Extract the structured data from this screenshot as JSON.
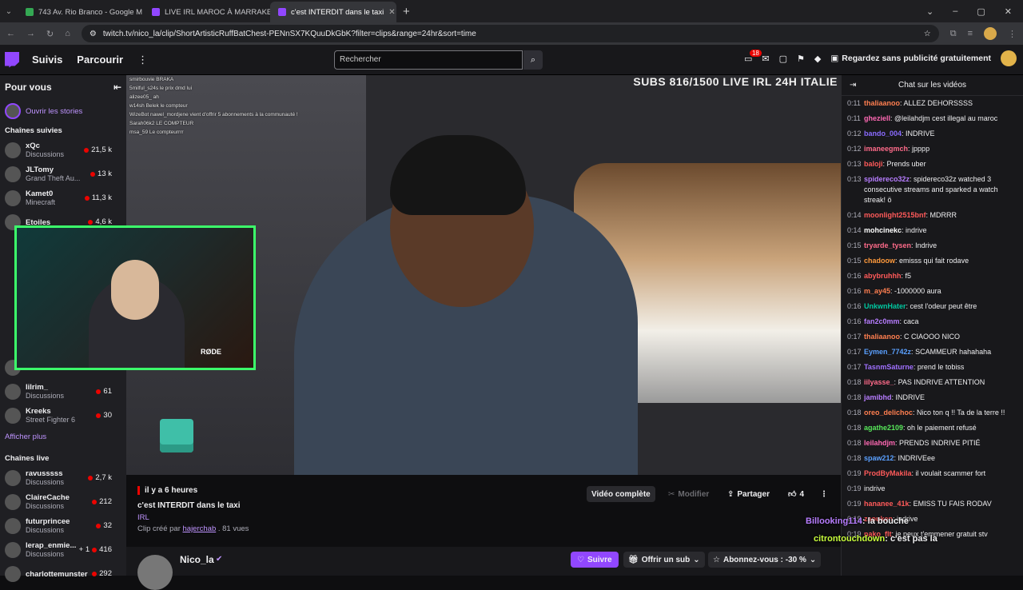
{
  "browser": {
    "tabs": [
      {
        "label": "743 Av. Rio Branco - Google M",
        "color": "#34a853",
        "active": false
      },
      {
        "label": "LIVE IRL MAROC À MARRAKECH",
        "color": "#9147ff",
        "active": false
      },
      {
        "label": "c'est INTERDIT dans le taxi",
        "color": "#9147ff",
        "active": true
      }
    ],
    "url": "twitch.tv/nico_la/clip/ShortArtisticRuffBatChest-PENnSX7KQuuDkGbK?filter=clips&range=24hr&sort=time"
  },
  "nav": {
    "following": "Suivis",
    "browse": "Parcourir",
    "search_placeholder": "Rechercher",
    "notif_count": "18",
    "promo": "Regardez sans publicité gratuitement"
  },
  "sidebar": {
    "title": "Pour vous",
    "stories": "Ouvrir les stories",
    "followed_title": "Chaînes suivies",
    "show_more": "Afficher plus",
    "live_title": "Chaînes live",
    "followed": [
      {
        "name": "xQc",
        "cat": "Discussions",
        "count": "21,5 k"
      },
      {
        "name": "JLTomy",
        "cat": "Grand Theft Au...",
        "count": "13 k"
      },
      {
        "name": "Kamet0",
        "cat": "Minecraft",
        "count": "11,3 k"
      },
      {
        "name": "Etoiles",
        "cat": "",
        "count": "4,6 k"
      }
    ],
    "followed_after": [
      {
        "name": "",
        "cat": "Discussions",
        "count": ""
      },
      {
        "name": "lilrim_",
        "cat": "Discussions",
        "count": "61"
      },
      {
        "name": "Kreeks",
        "cat": "Street Fighter 6",
        "count": "30"
      }
    ],
    "live": [
      {
        "name": "ravusssss",
        "cat": "Discussions",
        "count": "2,7 k"
      },
      {
        "name": "ClaireCache",
        "cat": "Discussions",
        "count": "212"
      },
      {
        "name": "futurprincee",
        "cat": "Discussions",
        "count": "32"
      },
      {
        "name": "lerap_enmie...",
        "extra": "+ 1",
        "cat": "Discussions",
        "count": "416"
      },
      {
        "name": "charlottemunster",
        "cat": "",
        "count": "292"
      }
    ]
  },
  "video": {
    "overlay_title": "SUBS 816/1500 LIVE IRL 24H ITALIE",
    "stream_chat": [
      "smirbouvie BRAKA",
      "5milful_s24s le prix dmd lui",
      "alizee05_ ah",
      "w14sh Belek le compteur",
      "WizeBot nawel_mordjene vient d'offrir 5 abonnements à la communauté !",
      "Sarah06k2 LE COMPTEUR",
      "msa_59 Le compteurrrr"
    ],
    "mic_label": "RØDE"
  },
  "clip": {
    "time": "il y a 6 heures",
    "title": "c'est INTERDIT dans le taxi",
    "category": "IRL",
    "created_prefix": "Clip créé par",
    "creator": "hajerchab",
    "views": ". 81 vues",
    "full_video": "Vidéo complète",
    "edit": "Modifier",
    "share": "Partager",
    "likes": "4"
  },
  "channel": {
    "name": "Nico_la",
    "follow": "Suivre",
    "gift": "Offrir un sub",
    "subscribe": "Abonnez-vous : -30 %"
  },
  "chat": {
    "title": "Chat sur les vidéos",
    "messages": [
      {
        "t": "0:11",
        "u": "thaliaanoo",
        "c": "#ff7f50",
        "m": "ALLEZ DEHORSSSS"
      },
      {
        "t": "0:11",
        "u": "gheziell",
        "c": "#ff69b4",
        "m": "@leilahdjm cest illegal au maroc"
      },
      {
        "t": "0:12",
        "u": "bando_004",
        "c": "#8a6bff",
        "m": "INDRIVE"
      },
      {
        "t": "0:12",
        "u": "imaneegmch",
        "c": "#ff6b8a",
        "m": "jpppp"
      },
      {
        "t": "0:13",
        "u": "baloji",
        "c": "#ff5a5a",
        "m": "Prends uber"
      },
      {
        "t": "0:13",
        "u": "spidereco32z",
        "c": "#b77dff",
        "m": "spidereco32z watched 3 consecutive streams and sparked a watch streak! ö"
      },
      {
        "t": "0:14",
        "u": "moonlight2515bnf",
        "c": "#ff5a5a",
        "m": "MDRRR"
      },
      {
        "t": "0:14",
        "u": "mohcinekc",
        "c": "#ffffff",
        "m": "indrive"
      },
      {
        "t": "0:15",
        "u": "tryarde_tysen",
        "c": "#ff6b8a",
        "m": "Indrive"
      },
      {
        "t": "0:15",
        "u": "chadoow",
        "c": "#ff9a3c",
        "m": "emisss qui fait rodave"
      },
      {
        "t": "0:16",
        "u": "abybruhhh",
        "c": "#ff5a5a",
        "m": "f5"
      },
      {
        "t": "0:16",
        "u": "m_ay45",
        "c": "#ff7f50",
        "m": "-1000000 aura"
      },
      {
        "t": "0:16",
        "u": "UnkwnHater",
        "c": "#00c8a0",
        "m": "cest l'odeur peut être"
      },
      {
        "t": "0:16",
        "u": "fan2c0mm",
        "c": "#b77dff",
        "m": "caca"
      },
      {
        "t": "0:17",
        "u": "thaliaanoo",
        "c": "#ff7f50",
        "m": "C CIAOOO NICO"
      },
      {
        "t": "0:17",
        "u": "Eymen_7742z",
        "c": "#5aa0ff",
        "m": "SCAMMEUR hahahaha"
      },
      {
        "t": "0:17",
        "u": "TasnmSaturne",
        "c": "#a070ff",
        "m": "prend le tobiss"
      },
      {
        "t": "0:18",
        "u": "iilyasse_",
        "c": "#ff6b8a",
        "m": "PAS INDRIVE ATTENTION"
      },
      {
        "t": "0:18",
        "u": "jamibhd",
        "c": "#b77dff",
        "m": "INDRIVE"
      },
      {
        "t": "0:18",
        "u": "oreo_delichoc",
        "c": "#ff7f50",
        "m": "Nico ton q !! Ta de la terre !!"
      },
      {
        "t": "0:18",
        "u": "agathe2109",
        "c": "#57e85a",
        "m": "oh le paiement refusé"
      },
      {
        "t": "0:18",
        "u": "leilahdjm",
        "c": "#ff69b4",
        "m": "PRENDS INDRIVE PITIÉ"
      },
      {
        "t": "0:18",
        "u": "spaw212",
        "c": "#5aa0ff",
        "m": "INDRIVEee"
      },
      {
        "t": "0:19",
        "u": "ProdByMakila",
        "c": "#ff5a5a",
        "m": "il voulait scammer fort"
      },
      {
        "t": "0:19",
        "u": "",
        "c": "#ffffff",
        "m": "indrive"
      },
      {
        "t": "0:19",
        "u": "hananee_41k",
        "c": "#ff5a5a",
        "m": "EMISS TU FAIS RODAV"
      },
      {
        "t": "0:19",
        "u": "zaouken",
        "c": "#ff5a5a",
        "m": "indrive"
      },
      {
        "t": "0:19",
        "u": "nako_flt",
        "c": "#ff5a5a",
        "m": "je peux t'emmener gratuit stv"
      }
    ],
    "floaters": [
      {
        "u": "Billooking114",
        "m": ": la bouche",
        "c": "#b77dff"
      },
      {
        "u": "citrontouchdown",
        "m": ": c'est pas la",
        "c": "#c8ff3c"
      }
    ]
  }
}
